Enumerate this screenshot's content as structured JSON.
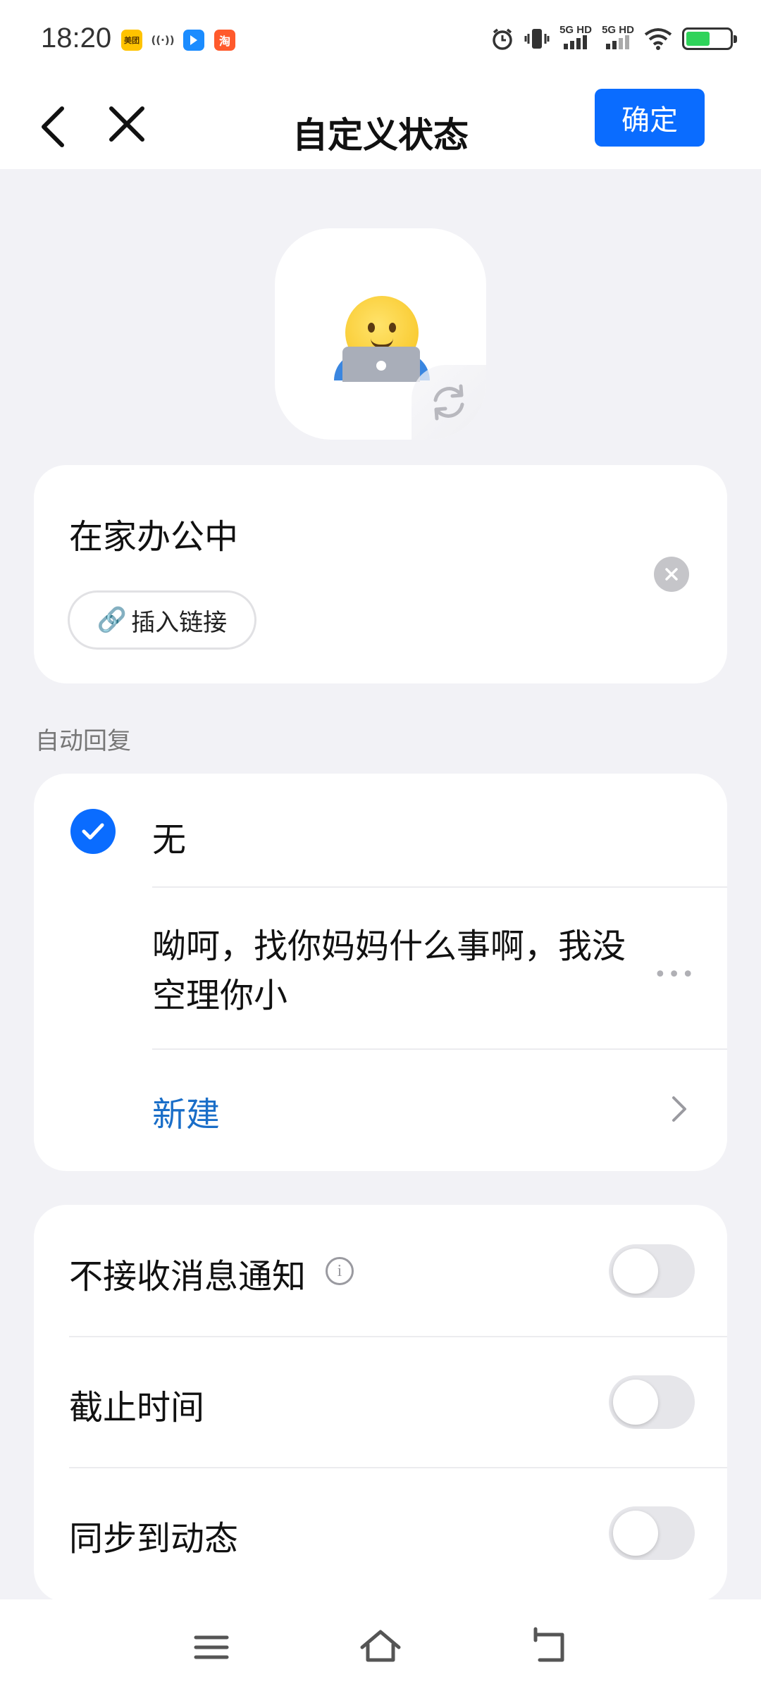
{
  "status_bar": {
    "time": "18:20",
    "app_icons": [
      {
        "name": "meituan-app-icon",
        "label": "美团",
        "color": "#ffc300"
      },
      {
        "name": "hotspot-icon",
        "label": "((·))",
        "color": "#ffffff"
      },
      {
        "name": "navigation-app-icon",
        "label": "",
        "color": "#1b8cff"
      },
      {
        "name": "taobao-app-icon",
        "label": "淘",
        "color": "#ff5a2c"
      }
    ],
    "signal_1": "5G HD",
    "signal_2": "5G HD",
    "battery_level": 0.55
  },
  "nav": {
    "title": "自定义状态",
    "confirm_label": "确定"
  },
  "status_card": {
    "text": "在家办公中",
    "insert_link_label": "插入链接",
    "link_emoji": "🔗"
  },
  "auto_reply": {
    "section_label": "自动回复",
    "none_label": "无",
    "message": "呦呵，找你妈妈什么事啊，我没空理你小",
    "more": "•••",
    "new_label": "新建"
  },
  "settings": {
    "items": [
      {
        "label": "不接收消息通知",
        "enabled": false
      },
      {
        "label": "截止时间",
        "enabled": false
      },
      {
        "label": "同步到动态",
        "enabled": false
      }
    ]
  },
  "colors": {
    "accent": "#0a6cff",
    "link": "#1a6ec8",
    "background": "#f2f2f6",
    "toggle_off": "#e6e6ea"
  }
}
